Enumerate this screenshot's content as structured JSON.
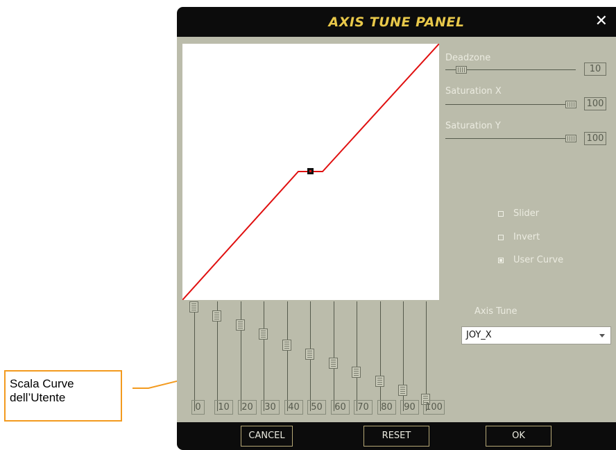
{
  "window": {
    "title": "AXIS TUNE PANEL",
    "close_glyph": "✕"
  },
  "controls": {
    "deadzone": {
      "label": "Deadzone",
      "value": "10",
      "level": 10
    },
    "saturation_x": {
      "label": "Saturation X",
      "value": "100",
      "level": 100
    },
    "saturation_y": {
      "label": "Saturation Y",
      "value": "100",
      "level": 100
    }
  },
  "checkboxes": [
    {
      "label": "Slider",
      "checked": false
    },
    {
      "label": "Invert",
      "checked": false
    },
    {
      "label": "User Curve",
      "checked": true
    }
  ],
  "axis_tune": {
    "label": "Axis Tune",
    "selected": "JOY_X"
  },
  "curve_sliders": [
    {
      "label": "0",
      "level": 100
    },
    {
      "label": "10",
      "level": 93
    },
    {
      "label": "20",
      "level": 86
    },
    {
      "label": "30",
      "level": 79
    },
    {
      "label": "40",
      "level": 71
    },
    {
      "label": "50",
      "level": 64
    },
    {
      "label": "60",
      "level": 57
    },
    {
      "label": "70",
      "level": 50
    },
    {
      "label": "80",
      "level": 43
    },
    {
      "label": "90",
      "level": 36
    },
    {
      "label": "100",
      "level": 29
    }
  ],
  "buttons": {
    "cancel": "CANCEL",
    "reset": "RESET",
    "ok": "OK"
  },
  "callout": {
    "line1": "Scala Curve",
    "line2": "dell’Utente"
  },
  "colors": {
    "curve": "#e01010",
    "title": "#e8c84a",
    "panel": "#bbbcab",
    "callout_border": "#f39a1e"
  },
  "icons": {
    "close": "close-icon",
    "dropdown": "chevron-down-icon"
  }
}
